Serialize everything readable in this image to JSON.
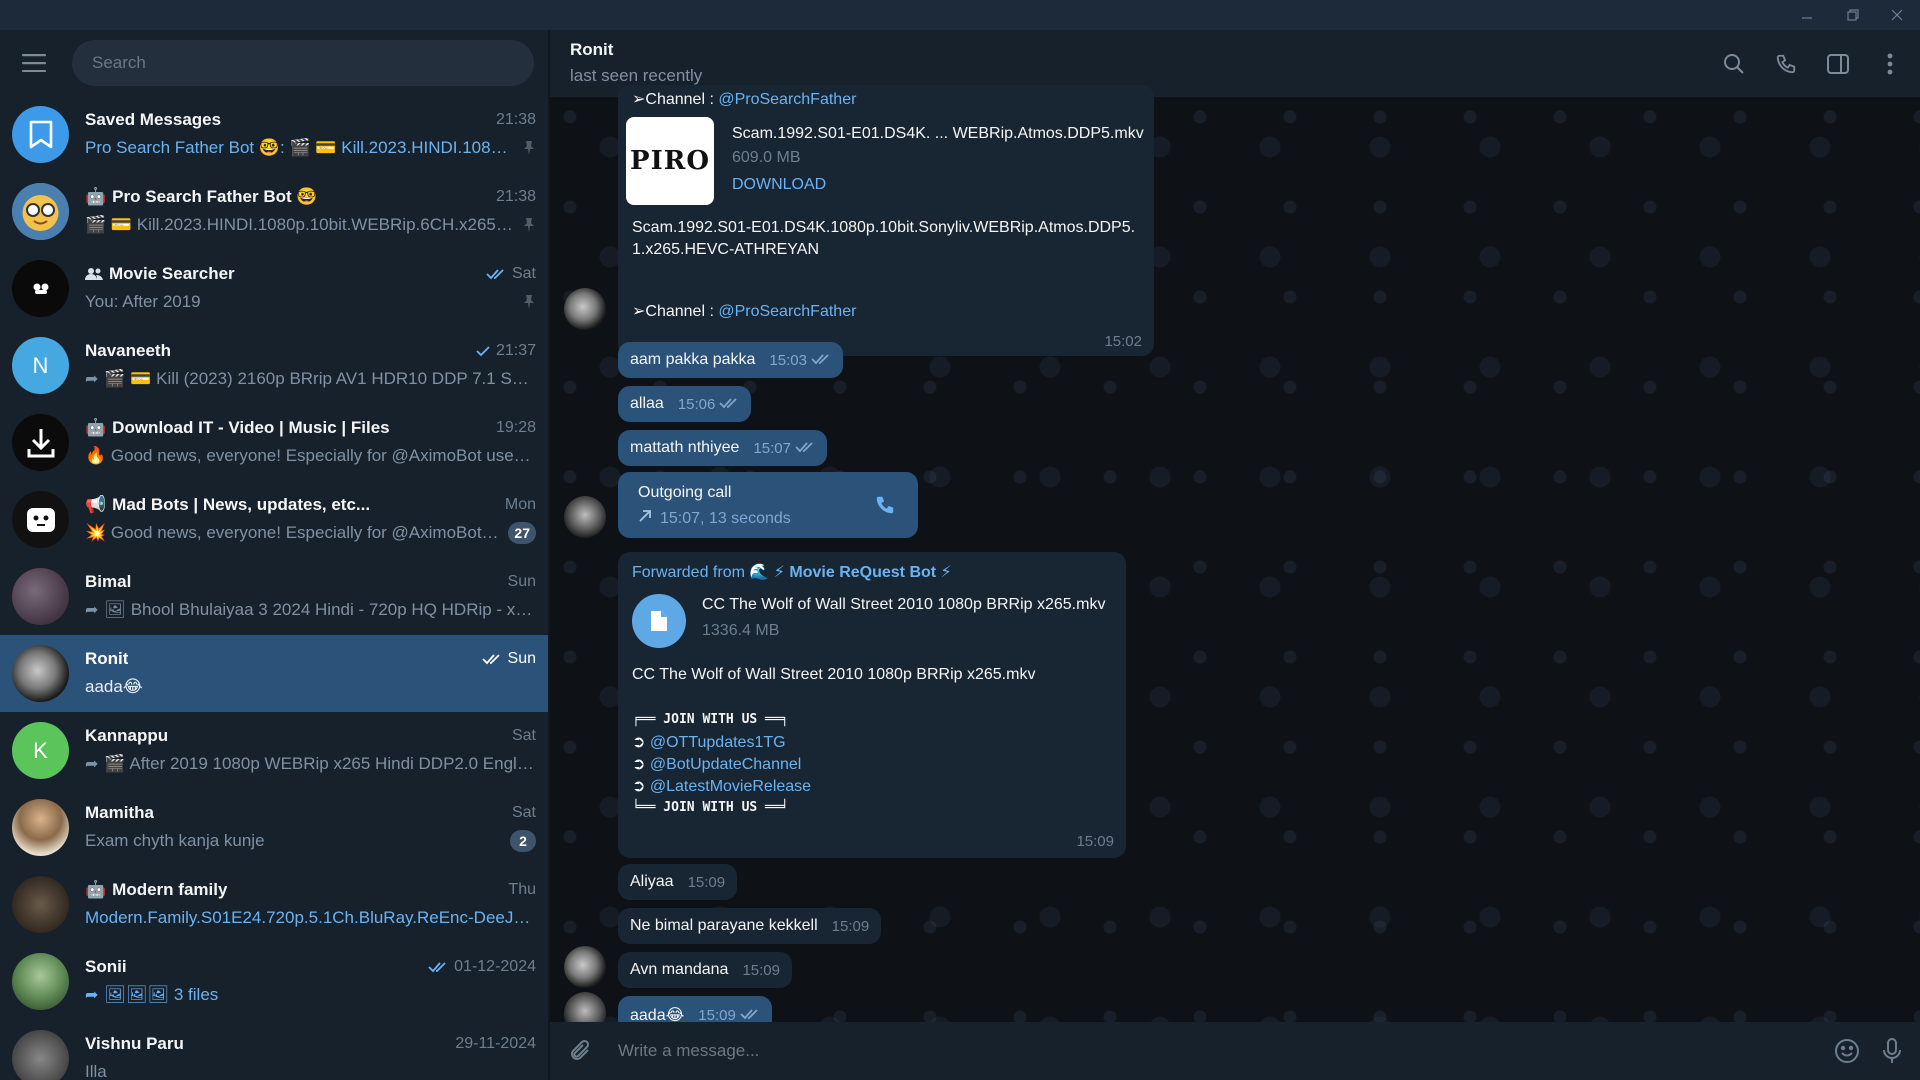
{
  "search": {
    "placeholder": "Search"
  },
  "chats": [
    {
      "name": "Saved Messages",
      "time": "21:38",
      "preview": "Pro Search Father Bot 🤓: 🎬 💳 Kill.2023.HINDI.1080...",
      "accent": true,
      "pinned": true
    },
    {
      "name": "Pro Search Father Bot 🤓",
      "time": "21:38",
      "preview": "🎬 💳 Kill.2023.HINDI.1080p.10bit.WEBRip.6CH.x265.H...",
      "pinned": true
    },
    {
      "name": "Movie Searcher",
      "time": "Sat",
      "preview": "You: After 2019",
      "pinned": true
    },
    {
      "name": "Navaneeth",
      "time": "21:37",
      "preview": "🎬 💳 Kill (2023) 2160p BRrip AV1 HDR10 DDP 7.1 SMK ..."
    },
    {
      "name": "Download IT - Video | Music | Files",
      "time": "19:28",
      "preview": "🔥 Good news, everyone! Especially for @AximoBot users!..."
    },
    {
      "name": "Mad Bots | News, updates, etc...",
      "time": "Mon",
      "preview": "💥 Good news, everyone! Especially for @AximoBot u...",
      "badge": "27"
    },
    {
      "name": "Bimal",
      "time": "Sun",
      "preview": "🖼 Bhool Bhulaiyaa 3 2024  Hindi - 720p HQ HDRip - x26..."
    },
    {
      "name": "Ronit",
      "time": "Sun",
      "preview": "aada😂"
    },
    {
      "name": "Kannappu",
      "time": "Sat",
      "preview": "🎬 After 2019 1080p WEBRip x265 Hindi DDP2.0 English..."
    },
    {
      "name": "Mamitha",
      "time": "Sat",
      "preview": "Exam chyth kanja kunje",
      "badge": "2"
    },
    {
      "name": "Modern family",
      "time": "Thu",
      "preview": "Modern.Family.S01E24.720p.5.1Ch.BluRay.ReEnc-DeeJayAh...",
      "accent": true
    },
    {
      "name": "Sonii",
      "time": "01-12-2024",
      "preview": "🖼🖼🖼 3 files"
    },
    {
      "name": "Vishnu Paru",
      "time": "29-11-2024",
      "preview": "Illa"
    }
  ],
  "avatar_letters": {
    "navaneeth": "N",
    "kannappu": "K"
  },
  "header": {
    "name": "Ronit",
    "status": "last seen recently"
  },
  "messages": {
    "top_channel_label": "➢Channel : ",
    "top_channel_link": "@ProSearchFather",
    "file1": {
      "name": "Scam.1992.S01-E01.DS4K. ... WEBRip.Atmos.DDP5.mkv",
      "size": "609.0 MB",
      "action": "DOWNLOAD",
      "thumb_text": "PIRO",
      "caption": "Scam.1992.S01-E01.DS4K.1080p.10bit.Sonyliv.WEBRip.Atmos.DDP5.1.x265.HEVC-ATHREYAN",
      "channel_label": "➢Channel : ",
      "channel_link": "@ProSearchFather",
      "time": "15:02"
    },
    "m1": {
      "text": "aam pakka pakka",
      "time": "15:03"
    },
    "m2": {
      "text": "allaa",
      "time": "15:06"
    },
    "m3": {
      "text": "mattath nthiyee",
      "time": "15:07"
    },
    "call": {
      "title": "Outgoing call",
      "detail": "15:07, 13 seconds"
    },
    "forward": {
      "from_label": "Forwarded from ",
      "from_name": "🌊 ⚡ Movie ReQuest Bot ⚡",
      "file_name": "CC The Wolf of Wall Street 2010 1080p BRRip x265.mkv",
      "file_size": "1336.4 MB",
      "caption": "CC The Wolf of Wall Street 2010 1080p BRRip x265.mkv",
      "join_top": "╒══ JOIN WITH US ══╕",
      "links": [
        "@OTTupdates1TG",
        "@BotUpdateChannel",
        "@LatestMovieRelease"
      ],
      "link_prefix": "➲ ",
      "join_bottom": "╘══ JOIN WITH US ══╛",
      "time": "15:09"
    },
    "in1": {
      "text": "Aliyaa",
      "time": "15:09"
    },
    "in2": {
      "text": "Ne bimal parayane kekkell",
      "time": "15:09"
    },
    "in3": {
      "text": "Avn mandana",
      "time": "15:09"
    },
    "m4": {
      "text": "aada😂",
      "time": "15:09"
    }
  },
  "composer": {
    "placeholder": "Write a message..."
  },
  "colors": {
    "accent": "#6ab3f3",
    "outgoing": "#2b5278",
    "incoming": "#182533",
    "sidebar": "#17212b"
  }
}
